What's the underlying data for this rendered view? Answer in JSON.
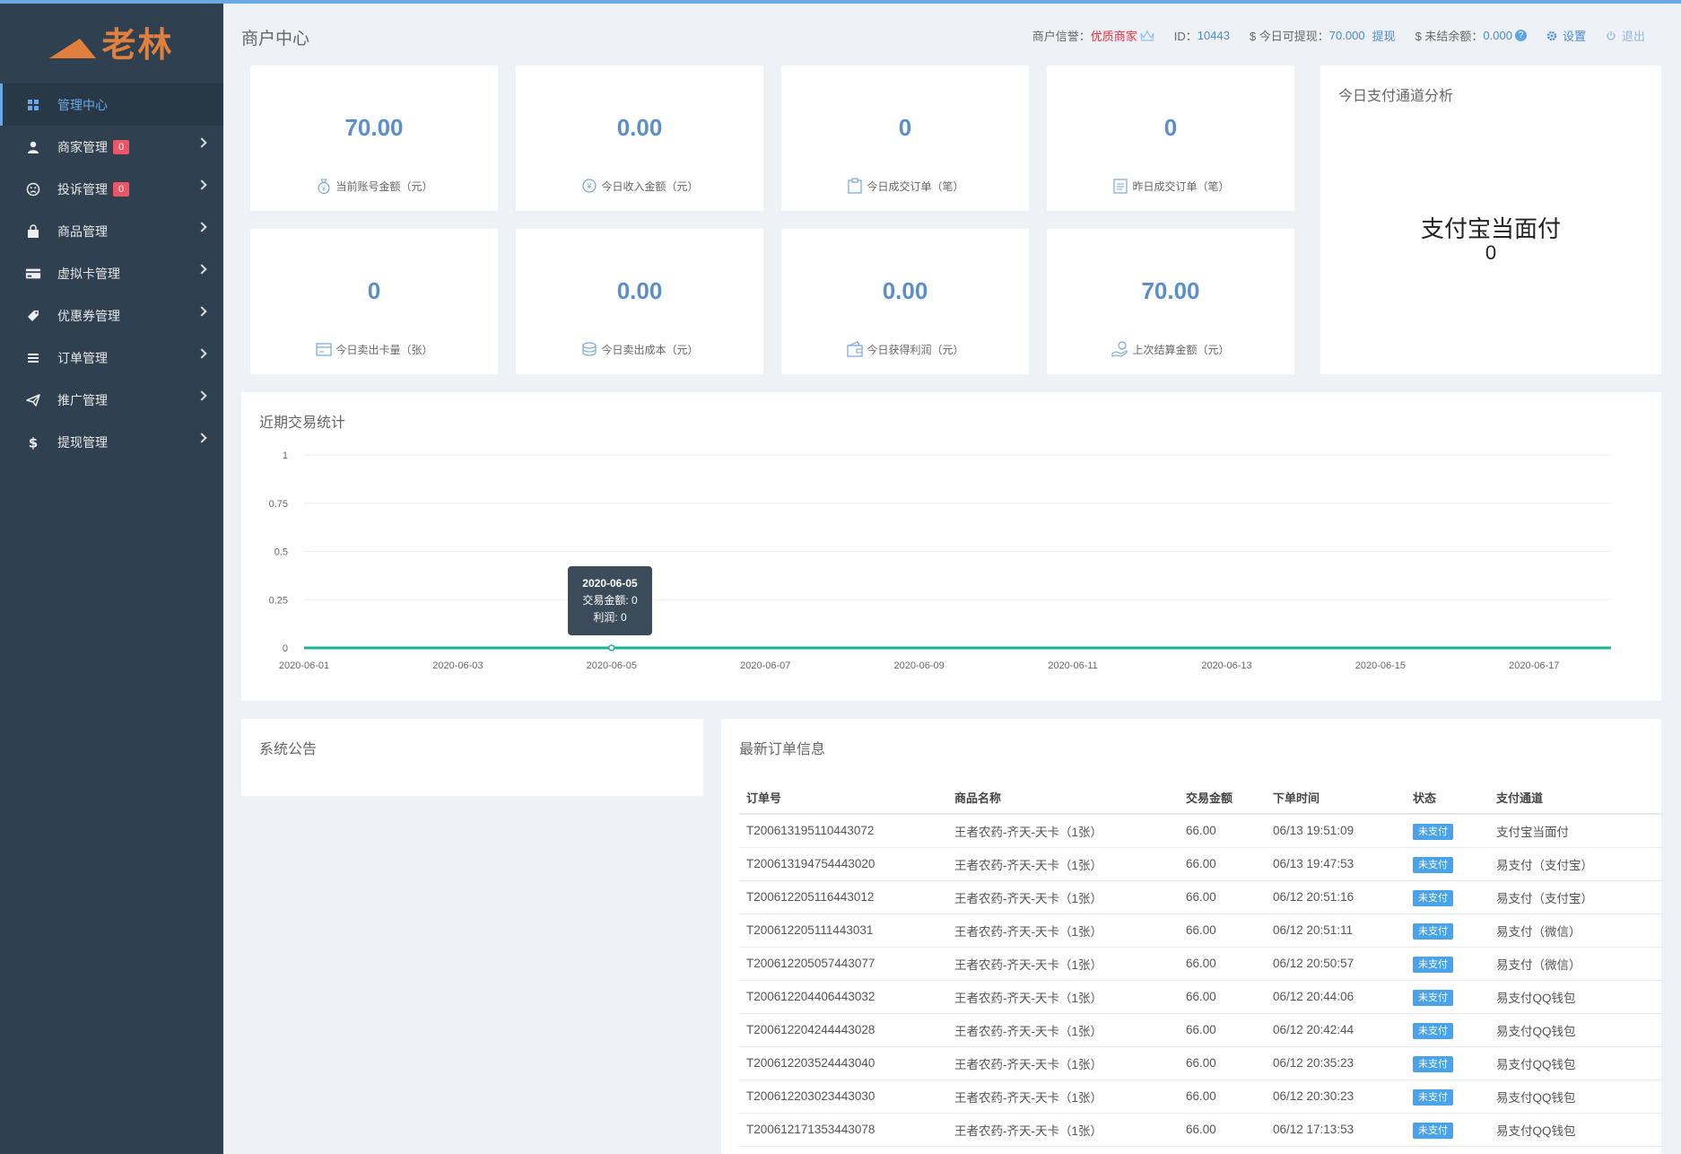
{
  "brand": {
    "logo_text": "老林"
  },
  "sidebar": {
    "items": [
      {
        "label": "管理中心",
        "icon": "dashboard-icon",
        "active": true,
        "badge": null,
        "chevron": false
      },
      {
        "label": "商家管理",
        "icon": "user-icon",
        "active": false,
        "badge": "0",
        "chevron": true
      },
      {
        "label": "投诉管理",
        "icon": "frown-icon",
        "active": false,
        "badge": "0",
        "chevron": true
      },
      {
        "label": "商品管理",
        "icon": "shopping-bag-icon",
        "active": false,
        "badge": null,
        "chevron": true
      },
      {
        "label": "虚拟卡管理",
        "icon": "credit-card-icon",
        "active": false,
        "badge": null,
        "chevron": true
      },
      {
        "label": "优惠券管理",
        "icon": "ticket-icon",
        "active": false,
        "badge": null,
        "chevron": true
      },
      {
        "label": "订单管理",
        "icon": "list-icon",
        "active": false,
        "badge": null,
        "chevron": true
      },
      {
        "label": "推广管理",
        "icon": "paper-plane-icon",
        "active": false,
        "badge": null,
        "chevron": true
      },
      {
        "label": "提现管理",
        "icon": "dollar-icon",
        "active": false,
        "badge": null,
        "chevron": true
      }
    ]
  },
  "header": {
    "title": "商户中心",
    "credit_label": "商户信誉：",
    "credit_value": "优质商家",
    "id_label": "ID：",
    "id_value": "10443",
    "withdraw_label": "$ 今日可提现：",
    "withdraw_value": "70.000",
    "withdraw_link": "提现",
    "unsettled_label": "$ 未结余额：",
    "unsettled_value": "0.000",
    "help": "?",
    "settings": "设置",
    "logout": "退出"
  },
  "stats": [
    {
      "value": "70.00",
      "label": "当前账号金额（元）",
      "icon": "money-bag-icon"
    },
    {
      "value": "0.00",
      "label": "今日收入金额（元）",
      "icon": "yen-coin-icon"
    },
    {
      "value": "0",
      "label": "今日成交订单（笔）",
      "icon": "clipboard-icon"
    },
    {
      "value": "0",
      "label": "昨日成交订单（笔）",
      "icon": "document-icon"
    },
    {
      "value": "0",
      "label": "今日卖出卡量（张）",
      "icon": "card-icon"
    },
    {
      "value": "0.00",
      "label": "今日卖出成本（元）",
      "icon": "coins-stack-icon"
    },
    {
      "value": "0.00",
      "label": "今日获得利润（元）",
      "icon": "wallet-icon"
    },
    {
      "value": "70.00",
      "label": "上次结算金额（元）",
      "icon": "hand-money-icon"
    }
  ],
  "channel_panel": {
    "title": "今日支付通道分析",
    "channel_name": "支付宝当面付",
    "channel_value": "0"
  },
  "chart_panel": {
    "title": "近期交易统计",
    "tooltip": {
      "date": "2020-06-05",
      "line1": "交易金额: 0",
      "line2": "利润: 0"
    }
  },
  "chart_data": {
    "type": "line",
    "x": [
      "2020-06-01",
      "2020-06-02",
      "2020-06-03",
      "2020-06-04",
      "2020-06-05",
      "2020-06-06",
      "2020-06-07",
      "2020-06-08",
      "2020-06-09",
      "2020-06-10",
      "2020-06-11",
      "2020-06-12",
      "2020-06-13",
      "2020-06-14",
      "2020-06-15",
      "2020-06-16",
      "2020-06-17",
      "2020-06-18"
    ],
    "x_tick_labels": [
      "2020-06-01",
      "2020-06-03",
      "2020-06-05",
      "2020-06-07",
      "2020-06-09",
      "2020-06-11",
      "2020-06-13",
      "2020-06-15",
      "2020-06-17"
    ],
    "y_tick_labels": [
      "0",
      "0.25",
      "0.5",
      "0.75",
      "1"
    ],
    "ylim": [
      0,
      1
    ],
    "series": [
      {
        "values": [
          0,
          0,
          0,
          0,
          0,
          0,
          0,
          0,
          0,
          0,
          0,
          0,
          0,
          0,
          0,
          0,
          0,
          0
        ],
        "color": "#1ab394"
      },
      {
        "values": [
          0,
          0,
          0,
          0,
          0,
          0,
          0,
          0,
          0,
          0,
          0,
          0,
          0,
          0,
          0,
          0,
          0,
          0
        ],
        "color": "#6aa8e6"
      }
    ],
    "grid": true
  },
  "notice_panel": {
    "title": "系统公告"
  },
  "orders_panel": {
    "title": "最新订单信息",
    "columns": [
      "订单号",
      "商品名称",
      "交易金额",
      "下单时间",
      "状态",
      "支付通道"
    ],
    "rows": [
      [
        "T200613195110443072",
        "王者农药-齐天-天卡（1张）",
        "66.00",
        "06/13 19:51:09",
        "未支付",
        "支付宝当面付"
      ],
      [
        "T200613194754443020",
        "王者农药-齐天-天卡（1张）",
        "66.00",
        "06/13 19:47:53",
        "未支付",
        "易支付（支付宝）"
      ],
      [
        "T200612205116443012",
        "王者农药-齐天-天卡（1张）",
        "66.00",
        "06/12 20:51:16",
        "未支付",
        "易支付（支付宝）"
      ],
      [
        "T200612205111443031",
        "王者农药-齐天-天卡（1张）",
        "66.00",
        "06/12 20:51:11",
        "未支付",
        "易支付（微信）"
      ],
      [
        "T200612205057443077",
        "王者农药-齐天-天卡（1张）",
        "66.00",
        "06/12 20:50:57",
        "未支付",
        "易支付（微信）"
      ],
      [
        "T200612204406443032",
        "王者农药-齐天-天卡（1张）",
        "66.00",
        "06/12 20:44:06",
        "未支付",
        "易支付QQ钱包"
      ],
      [
        "T200612204244443028",
        "王者农药-齐天-天卡（1张）",
        "66.00",
        "06/12 20:42:44",
        "未支付",
        "易支付QQ钱包"
      ],
      [
        "T200612203524443040",
        "王者农药-齐天-天卡（1张）",
        "66.00",
        "06/12 20:35:23",
        "未支付",
        "易支付QQ钱包"
      ],
      [
        "T200612203023443030",
        "王者农药-齐天-天卡（1张）",
        "66.00",
        "06/12 20:30:23",
        "未支付",
        "易支付QQ钱包"
      ],
      [
        "T200612171353443078",
        "王者农药-齐天-天卡（1张）",
        "66.00",
        "06/12 17:13:53",
        "未支付",
        "易支付QQ钱包"
      ]
    ]
  }
}
